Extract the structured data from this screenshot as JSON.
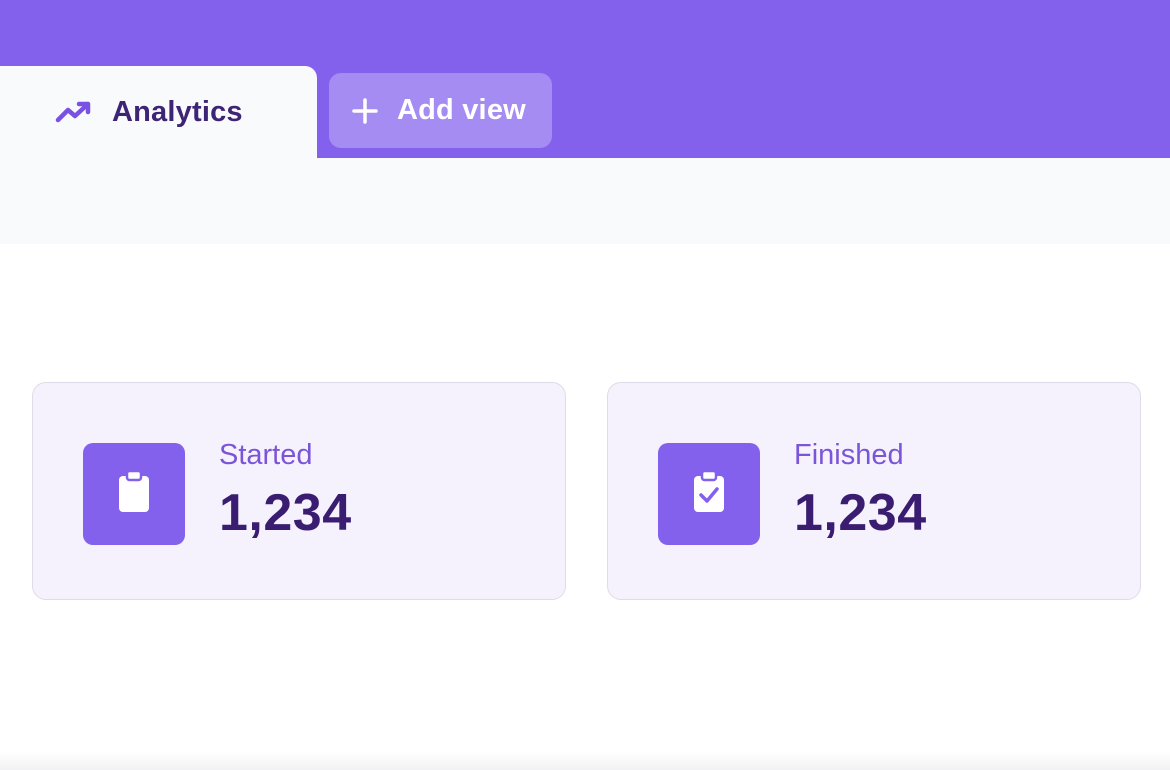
{
  "tabs": {
    "active": {
      "label": "Analytics",
      "icon": "trending-up-icon"
    },
    "add_view": {
      "label": "Add view",
      "icon": "plus-icon"
    }
  },
  "stats": [
    {
      "title": "Started",
      "value": "1,234",
      "icon": "clipboard-icon"
    },
    {
      "title": "Finished",
      "value": "1,234",
      "icon": "clipboard-check-icon"
    }
  ],
  "colors": {
    "brand": "#8361ec",
    "brand_light": "#a48cf3",
    "text_dark": "#3a1d70",
    "text_muted": "#7b55d8",
    "card_bg": "#f5f2fe",
    "page_bg": "#ffffff",
    "subbar_bg": "#f9fafc"
  }
}
